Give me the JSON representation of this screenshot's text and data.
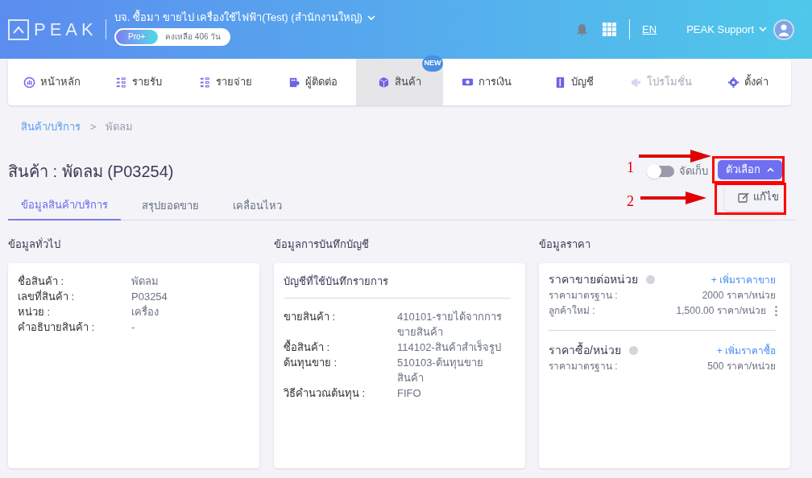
{
  "header": {
    "logo": "PEAK",
    "company": "บจ. ซื้อมา ขายไป เครื่องใช้ไฟฟ้า(Test) (สำนักงานใหญ่)",
    "plan": "Pro+",
    "remaining": "คงเหลือ 406 วัน",
    "language": "EN",
    "user": "PEAK Support"
  },
  "nav": [
    {
      "label": "หน้าหลัก",
      "selected": false,
      "disabled": false
    },
    {
      "label": "รายรับ",
      "selected": false,
      "disabled": false
    },
    {
      "label": "รายจ่าย",
      "selected": false,
      "disabled": false
    },
    {
      "label": "ผู้ติดต่อ",
      "selected": false,
      "disabled": false
    },
    {
      "label": "สินค้า",
      "selected": true,
      "disabled": false,
      "badge": "NEW"
    },
    {
      "label": "การเงิน",
      "selected": false,
      "disabled": false
    },
    {
      "label": "บัญชี",
      "selected": false,
      "disabled": false
    },
    {
      "label": "โปรโมชั่น",
      "selected": false,
      "disabled": true
    },
    {
      "label": "ตั้งค่า",
      "selected": false,
      "disabled": false
    }
  ],
  "breadcrumb": [
    "สินค้า/บริการ",
    "พัดลม"
  ],
  "breadcrumb_separator": ">",
  "title": "สินค้า : พัดลม (P03254)",
  "archive_toggle": {
    "label": "จัดเก็บ",
    "on": false
  },
  "options_button": "ตัวเลือก",
  "options_menu": [
    "แก้ไข"
  ],
  "tabs": [
    {
      "label": "ข้อมูลสินค้า/บริการ",
      "selected": true
    },
    {
      "label": "สรุปยอดขาย",
      "selected": false
    },
    {
      "label": "เคลื่อนไหว",
      "selected": false
    }
  ],
  "general": {
    "heading": "ข้อมูลทั่วไป",
    "rows": [
      {
        "label": "ชื่อสินค้า :",
        "value": "พัดลม"
      },
      {
        "label": "เลขที่สินค้า :",
        "value": "P03254"
      },
      {
        "label": "หน่วย :",
        "value": "เครื่อง"
      },
      {
        "label": "คำอธิบายสินค้า :",
        "value": "-"
      }
    ]
  },
  "accounting": {
    "heading": "ข้อมูลการบันทึกบัญชี",
    "card_title": "บัญชีที่ใช้บันทึกรายการ",
    "rows": [
      {
        "label": "ขายสินค้า :",
        "value": "410101-รายได้จากการขายสินค้า"
      },
      {
        "label": "ซื้อสินค้า :",
        "value": "114102-สินค้าสำเร็จรูป"
      },
      {
        "label": "ต้นทุนขาย :",
        "value": "510103-ต้นทุนขายสินค้า"
      },
      {
        "label": "วิธีคำนวณต้นทุน :",
        "value": "FIFO"
      }
    ]
  },
  "pricing": {
    "heading": "ข้อมูลราคา",
    "groups": [
      {
        "title": "ราคาขายต่อหน่วย",
        "add_link": "+ เพิ่มราคาขาย",
        "rows": [
          {
            "label": "ราคามาตรฐาน :",
            "value": "2000 ราคา/หน่วย",
            "menu": false
          },
          {
            "label": "ลูกค้าใหม่ :",
            "value": "1,500.00 ราคา/หน่วย",
            "menu": true
          }
        ]
      },
      {
        "title": "ราคาซื้อ/หน่วย",
        "add_link": "+ เพิ่มราคาซื้อ",
        "rows": [
          {
            "label": "ราคามาตรฐาน :",
            "value": "500 ราคา/หน่วย",
            "menu": false
          }
        ]
      }
    ]
  },
  "annotations": [
    {
      "number": "1"
    },
    {
      "number": "2"
    }
  ]
}
